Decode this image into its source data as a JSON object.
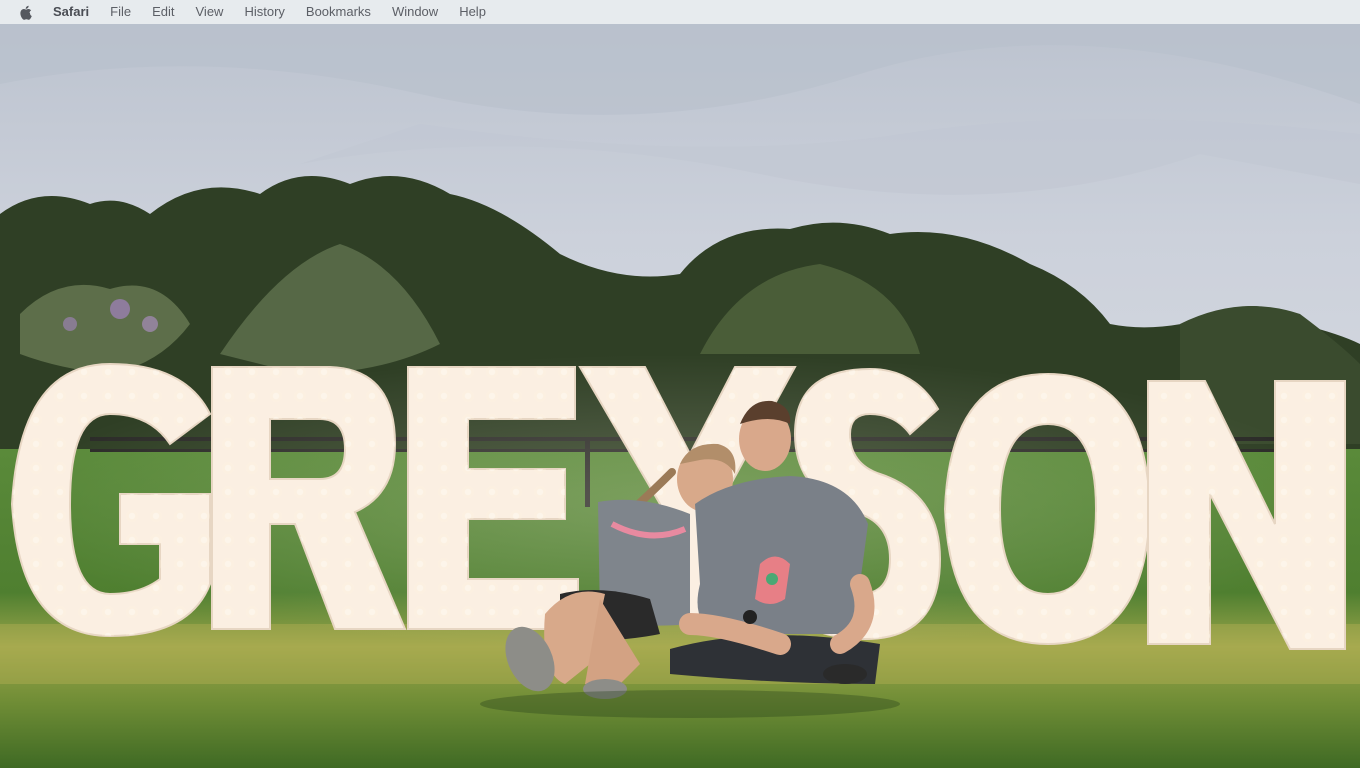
{
  "menubar": {
    "apple_icon": "apple-logo-icon",
    "app_name": "Safari",
    "items": [
      "File",
      "Edit",
      "View",
      "History",
      "Bookmarks",
      "Window",
      "Help"
    ]
  },
  "photo": {
    "sign_letters": [
      "G",
      "R",
      "E",
      "Y",
      "S",
      "O",
      "N"
    ],
    "shirt_text": "GREYSON"
  },
  "colors": {
    "sky": "#c9ced8",
    "trees": "#2c3b22",
    "grass": "#5d8a34",
    "marquee": "#fbeee0"
  }
}
